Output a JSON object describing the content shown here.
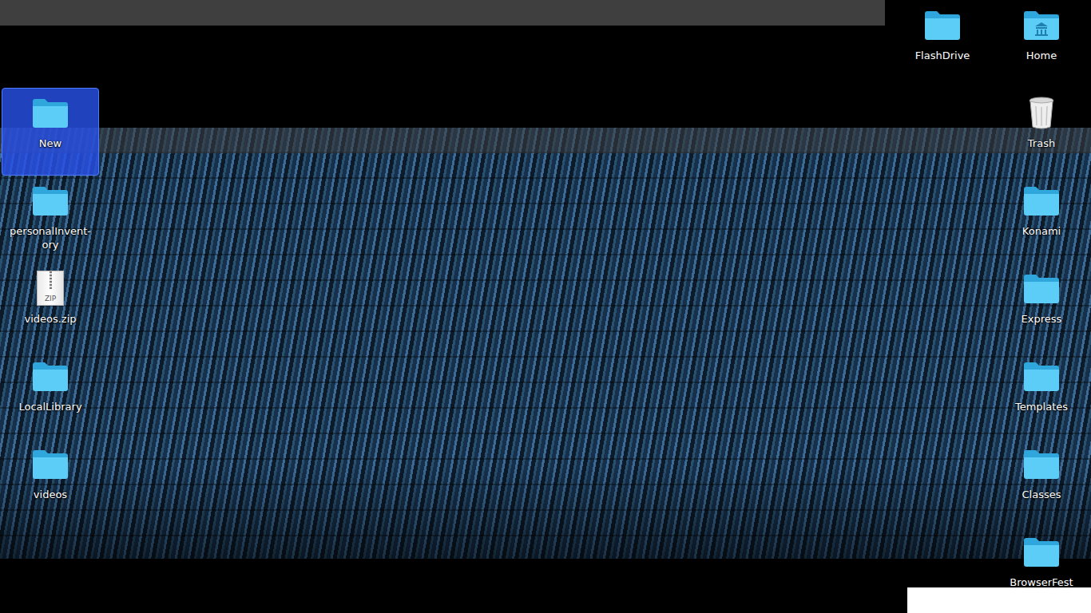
{
  "desktop": {
    "left_icons": [
      {
        "kind": "folder",
        "lines": [
          "New"
        ],
        "selected": true
      },
      {
        "kind": "folder",
        "lines": [
          "personalInvent-",
          "ory"
        ],
        "selected": false
      },
      {
        "kind": "zip",
        "lines": [
          "videos.zip"
        ],
        "badge": "ZIP",
        "selected": false
      },
      {
        "kind": "folder",
        "lines": [
          "LocalLibrary"
        ],
        "selected": false
      },
      {
        "kind": "folder",
        "lines": [
          "videos"
        ],
        "selected": false
      }
    ],
    "top_icons": [
      {
        "kind": "folder",
        "lines": [
          "FlashDrive"
        ],
        "selected": false
      }
    ],
    "right_icons": [
      {
        "kind": "home",
        "lines": [
          "Home"
        ],
        "selected": false
      },
      {
        "kind": "trash",
        "lines": [
          "Trash"
        ],
        "selected": false
      },
      {
        "kind": "folder",
        "lines": [
          "Konami"
        ],
        "selected": false
      },
      {
        "kind": "folder",
        "lines": [
          "Express"
        ],
        "selected": false
      },
      {
        "kind": "folder",
        "lines": [
          "Templates"
        ],
        "selected": false
      },
      {
        "kind": "folder",
        "lines": [
          "Classes"
        ],
        "selected": false
      },
      {
        "kind": "folder",
        "lines": [
          "BrowserFest"
        ],
        "selected": false
      }
    ]
  }
}
